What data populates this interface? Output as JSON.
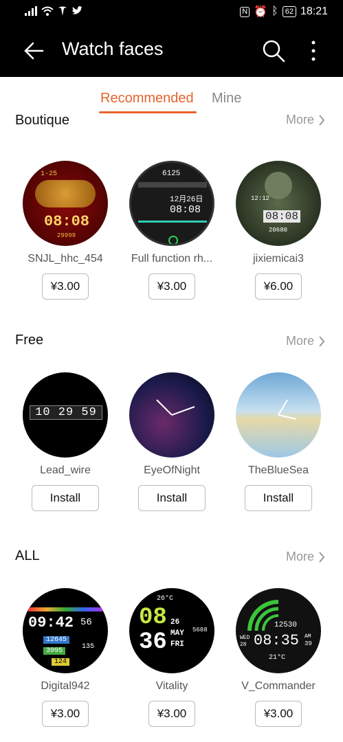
{
  "status": {
    "time": "18:21",
    "battery": "62"
  },
  "appbar": {
    "title": "Watch faces"
  },
  "tabs": {
    "recommended": "Recommended",
    "mine": "Mine"
  },
  "sections": {
    "boutique": {
      "title": "Boutique",
      "more": "More",
      "items": [
        {
          "name": "SNJL_hhc_454",
          "action": "¥3.00",
          "time": "08:08",
          "date": "1-25",
          "steps": "29999"
        },
        {
          "name": "Full function rh...",
          "action": "¥3.00",
          "time": "08:08",
          "date": "12月26日",
          "steps": "6125"
        },
        {
          "name": "jixiemicai3",
          "action": "¥6.00",
          "time": "08:08",
          "date": "12:12",
          "steps": "20680"
        }
      ]
    },
    "free": {
      "title": "Free",
      "more": "More",
      "items": [
        {
          "name": "Lead_wire",
          "action": "Install",
          "time": "10 29 59"
        },
        {
          "name": "EyeOfNight",
          "action": "Install"
        },
        {
          "name": "TheBlueSea",
          "action": "Install"
        }
      ]
    },
    "all": {
      "title": "ALL",
      "more": "More",
      "items": [
        {
          "name": "Digital942",
          "action": "¥3.00",
          "time": "09:42",
          "seconds": "56",
          "steps": "12645",
          "kcal": "3995",
          "pm": "124",
          "bpm": "135"
        },
        {
          "name": "Vitality",
          "action": "¥3.00",
          "hour": "08",
          "minute": "36",
          "temp": "26°C",
          "day": "26",
          "month": "MAY",
          "weekday": "FRI",
          "steps": "5688"
        },
        {
          "name": "V_Commander",
          "action": "¥3.00",
          "time": "08:35",
          "steps": "12530",
          "temp": "21°C",
          "ampm": "AM",
          "sec": "39",
          "weekday": "WED",
          "date": "28"
        }
      ]
    }
  },
  "colors": {
    "accent": "#e8632b"
  }
}
